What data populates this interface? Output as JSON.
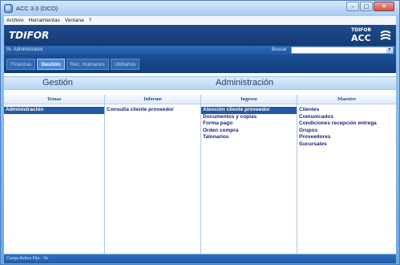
{
  "window": {
    "title": "ACC 3.0 (DCO)"
  },
  "menu": [
    "Archivo",
    "Herramientas",
    "Ventana",
    "?"
  ],
  "brand": {
    "name": "TDIFOR",
    "logo_top": "TDIFOR",
    "logo_main": "ACC"
  },
  "userbar": {
    "user": "Sr. Administrador",
    "search_label": "Buscar",
    "search_value": ""
  },
  "tabs": [
    "Finanzas",
    "Gestión",
    "Rec. Humanos",
    "Utilitarios"
  ],
  "section": {
    "left": "Gestión",
    "right": "Administración"
  },
  "columns": {
    "temas": {
      "header": "Temas",
      "items": [
        "Administración"
      ]
    },
    "informe": {
      "header": "Informe",
      "items": [
        "Consulta cliente proveedor"
      ]
    },
    "ingreso": {
      "header": "Ingreso",
      "items": [
        "Atención cliente proveedor",
        "Documentos y copias",
        "Forma pago",
        "Orden compra",
        "Talonarios"
      ]
    },
    "maestro": {
      "header": "Maestro",
      "items": [
        "Clientes",
        "Comunicados",
        "Condiciones recepción entrega",
        "Grupos",
        "Proveedores",
        "Sucursales"
      ]
    }
  },
  "status": {
    "text": "Carga Activo Fijo : 3s"
  },
  "colors": {
    "accent": "#1a4f97",
    "selection": "#2457a8",
    "link": "#1a237e"
  }
}
